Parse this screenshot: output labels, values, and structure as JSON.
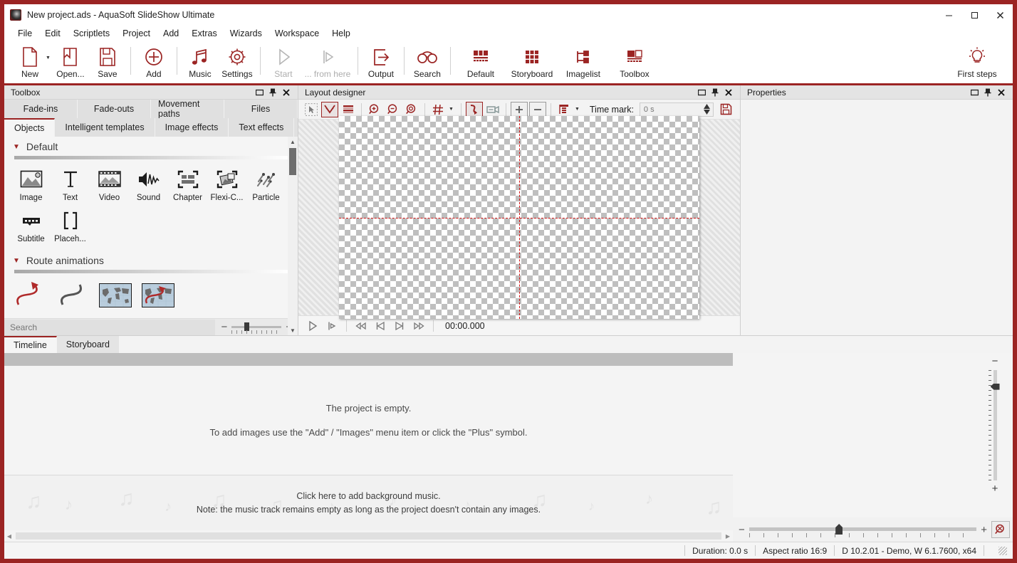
{
  "window": {
    "title": "New project.ads - AquaSoft SlideShow Ultimate",
    "minimize": "—",
    "maximize": "□",
    "close": "✕"
  },
  "menu": [
    {
      "label": "File"
    },
    {
      "label": "Edit"
    },
    {
      "label": "Scriptlets"
    },
    {
      "label": "Project"
    },
    {
      "label": "Add"
    },
    {
      "label": "Extras"
    },
    {
      "label": "Wizards"
    },
    {
      "label": "Workspace"
    },
    {
      "label": "Help"
    }
  ],
  "toolbar": {
    "buttons": [
      {
        "label": "New",
        "icon": "new-document-icon",
        "disabled": false,
        "has_caret": true
      },
      {
        "label": "Open...",
        "icon": "open-folder-icon",
        "disabled": false
      },
      {
        "label": "Save",
        "icon": "floppy-disk-icon",
        "disabled": false
      },
      {
        "label": "Add",
        "icon": "plus-circle-icon",
        "disabled": false
      },
      {
        "label": "Music",
        "icon": "music-note-icon",
        "disabled": false
      },
      {
        "label": "Settings",
        "icon": "gear-icon",
        "disabled": false
      },
      {
        "label": "Start",
        "icon": "play-triangle-icon",
        "disabled": true
      },
      {
        "label": "... from here",
        "icon": "play-from-here-icon",
        "disabled": true
      },
      {
        "label": "Output",
        "icon": "export-arrow-icon",
        "disabled": false
      },
      {
        "label": "Search",
        "icon": "binoculars-icon",
        "disabled": false
      },
      {
        "label": "Default",
        "icon": "default-layout-icon",
        "disabled": false
      },
      {
        "label": "Storyboard",
        "icon": "grid-squares-icon",
        "disabled": false
      },
      {
        "label": "Imagelist",
        "icon": "imagelist-tree-icon",
        "disabled": false
      },
      {
        "label": "Toolbox",
        "icon": "toolbox-panel-icon",
        "disabled": false
      }
    ],
    "first_steps": {
      "label": "First steps",
      "icon": "lightbulb-icon"
    }
  },
  "toolbox": {
    "caption": "Toolbox",
    "tabs_row1": [
      {
        "label": "Fade-ins",
        "active": false
      },
      {
        "label": "Fade-outs",
        "active": false
      },
      {
        "label": "Movement paths",
        "active": false
      },
      {
        "label": "Files",
        "active": false
      }
    ],
    "tabs_row2": [
      {
        "label": "Objects",
        "active": true
      },
      {
        "label": "Intelligent templates",
        "active": false
      },
      {
        "label": "Image effects",
        "active": false
      },
      {
        "label": "Text effects",
        "active": false
      }
    ],
    "groups": [
      {
        "title": "Default",
        "items": [
          {
            "label": "Image",
            "icon": "image-object-icon"
          },
          {
            "label": "Text",
            "icon": "text-object-icon"
          },
          {
            "label": "Video",
            "icon": "video-filmstrip-icon"
          },
          {
            "label": "Sound",
            "icon": "speaker-waveform-icon"
          },
          {
            "label": "Chapter",
            "icon": "chapter-icon"
          },
          {
            "label": "Flexi-C...",
            "icon": "flexi-collage-icon"
          },
          {
            "label": "Particle",
            "icon": "particle-icon"
          },
          {
            "label": "Subtitle",
            "icon": "subtitle-icon"
          },
          {
            "label": "Placeh...",
            "icon": "placeholder-brackets-icon"
          }
        ]
      },
      {
        "title": "Route animations",
        "items": [
          {
            "label": "",
            "icon": "red-s-curve-arrow-icon"
          },
          {
            "label": "",
            "icon": "gray-s-curve-icon"
          },
          {
            "label": "",
            "icon": "world-map-icon"
          },
          {
            "label": "",
            "icon": "world-map-route-icon"
          }
        ]
      }
    ],
    "search_placeholder": "Search",
    "zoom_minus": "−",
    "zoom_plus": "+"
  },
  "layout_designer": {
    "caption": "Layout designer",
    "tools": [
      {
        "name": "select-tool",
        "active": false
      },
      {
        "name": "fade-curve-tool",
        "active": true
      },
      {
        "name": "layers-tool",
        "active": false
      },
      {
        "name": "zoom-in-tool",
        "active": false
      },
      {
        "name": "zoom-out-tool",
        "active": false
      },
      {
        "name": "zoom-fit-tool",
        "active": false
      },
      {
        "name": "grid-tool",
        "active": false
      },
      {
        "name": "motion-path-tool",
        "active": true
      },
      {
        "name": "camera-pan-tool",
        "active": false
      },
      {
        "name": "add-keyframe-tool",
        "active": false
      },
      {
        "name": "remove-keyframe-tool",
        "active": false
      },
      {
        "name": "alignment-tool",
        "active": false
      }
    ],
    "time_mark_label": "Time mark:",
    "time_mark_value": "",
    "time_mark_placeholder": "0 s",
    "save_icon": "floppy-disk-icon",
    "player": {
      "play": "play-icon",
      "play_from_here": "play-from-here-icon",
      "rewind": "rewind-icon",
      "prev": "previous-icon",
      "next": "next-icon",
      "forward": "fast-forward-icon",
      "timecode": "00:00.000"
    }
  },
  "properties": {
    "caption": "Properties"
  },
  "timeline": {
    "tabs": [
      {
        "label": "Timeline",
        "active": true
      },
      {
        "label": "Storyboard",
        "active": false
      }
    ],
    "empty_line1": "The project is empty.",
    "empty_line2": "To add images use the \"Add\" / \"Images\" menu item or click the \"Plus\" symbol.",
    "music_line1": "Click here to add background music.",
    "music_line2": "Note: the music track remains empty as long as the project doesn't contain any images.",
    "zoom_minus": "−",
    "zoom_plus": "+",
    "magnify_icon": "magnifier-reset-icon"
  },
  "statusbar": {
    "duration": "Duration: 0.0 s",
    "aspect_ratio": "Aspect ratio 16:9",
    "build_info": "D 10.2.01 - Demo, W 6.1.7600, x64"
  },
  "colors": {
    "accent": "#9b2423",
    "frame": "#9b2423",
    "guide": "#d21414",
    "panel": "#f3f3f3"
  }
}
